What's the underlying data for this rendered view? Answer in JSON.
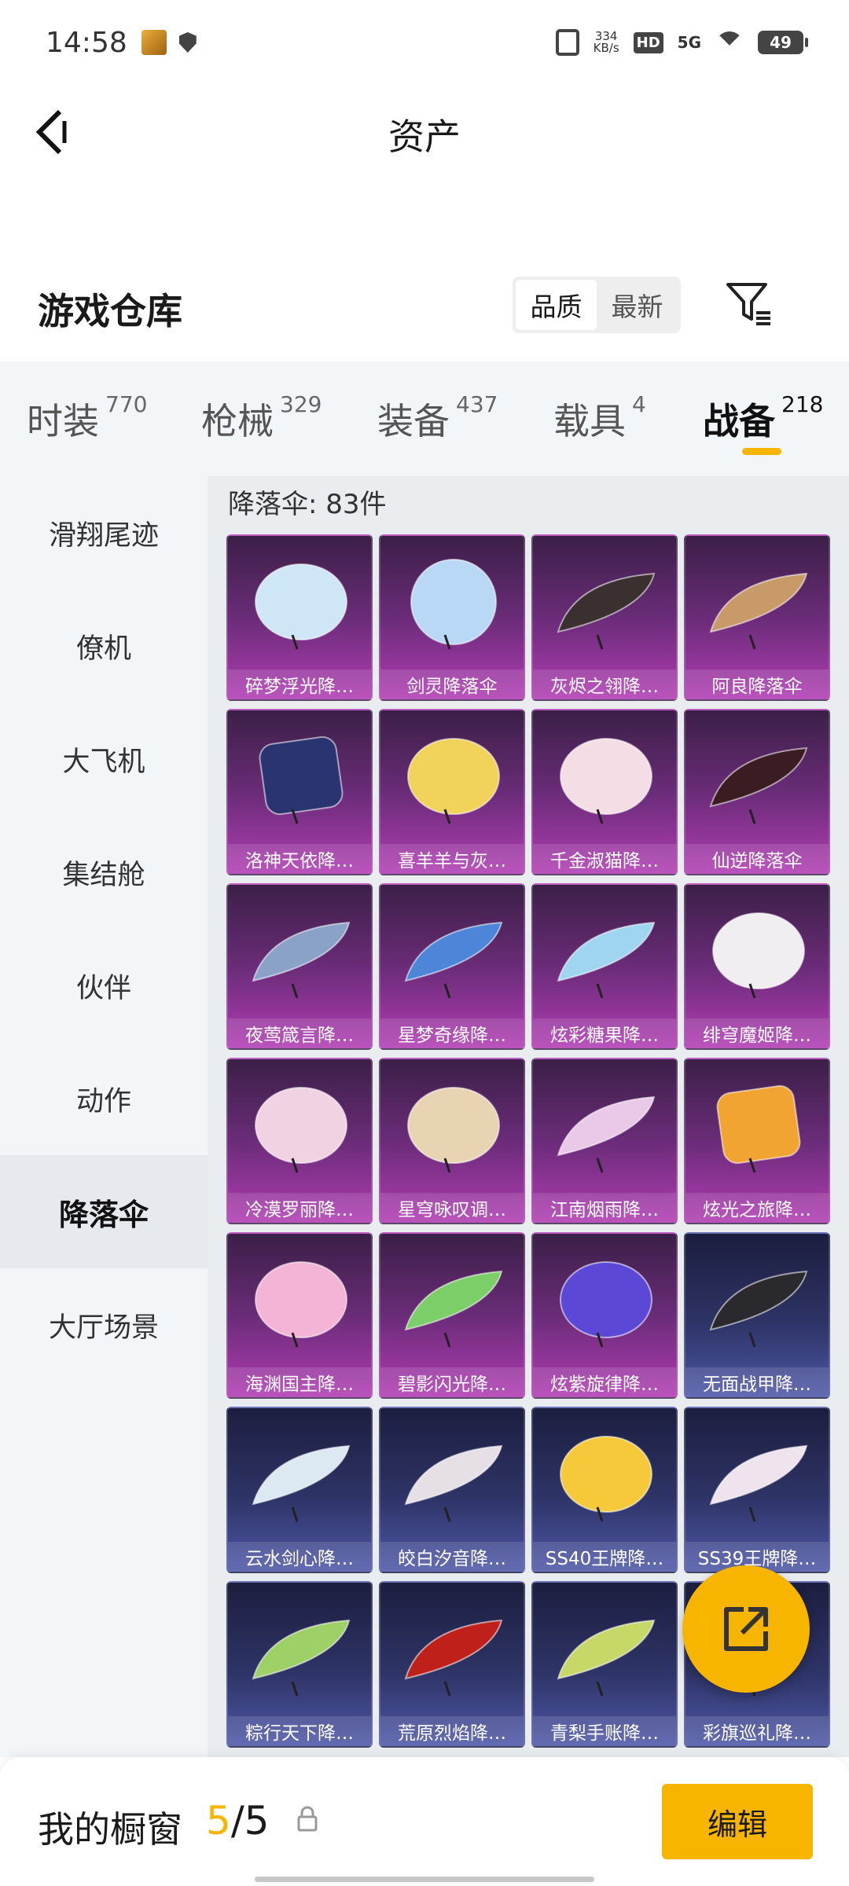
{
  "status_bar": {
    "time": "14:58",
    "net_speed": "334",
    "net_unit": "KB/s",
    "hd": "HD",
    "signal": "5G",
    "battery": "49"
  },
  "header": {
    "title": "资产"
  },
  "warehouse": {
    "title": "游戏仓库",
    "sort_options": [
      "品质",
      "最新"
    ],
    "active_sort": "品质"
  },
  "tabs": [
    {
      "label": "时装",
      "count": "770"
    },
    {
      "label": "枪械",
      "count": "329"
    },
    {
      "label": "装备",
      "count": "437"
    },
    {
      "label": "载具",
      "count": "4"
    },
    {
      "label": "战备",
      "count": "218"
    }
  ],
  "active_tab": "战备",
  "sidebar": {
    "items": [
      "滑翔尾迹",
      "僚机",
      "大飞机",
      "集结舱",
      "伙伴",
      "动作",
      "降落伞",
      "大厅场景"
    ],
    "active": "降落伞"
  },
  "content": {
    "section_title": "降落伞: 83件",
    "items": [
      {
        "name": "碎梦浮光降…",
        "tier": "purple",
        "art": "round",
        "color": "#cfe6f7"
      },
      {
        "name": "剑灵降落伞",
        "tier": "purple",
        "art": "flower",
        "color": "#b9d8f5"
      },
      {
        "name": "灰烬之翎降…",
        "tier": "purple",
        "art": "wing",
        "color": "#3a3030"
      },
      {
        "name": "阿良降落伞",
        "tier": "purple",
        "art": "wing",
        "color": "#c89a6a"
      },
      {
        "name": "洛神天依降…",
        "tier": "purple",
        "art": "square",
        "color": "#2a3470"
      },
      {
        "name": "喜羊羊与灰…",
        "tier": "purple",
        "art": "round",
        "color": "#f1d25a"
      },
      {
        "name": "千金淑猫降…",
        "tier": "purple",
        "art": "round",
        "color": "#f4dde4"
      },
      {
        "name": "仙逆降落伞",
        "tier": "purple",
        "art": "wing",
        "color": "#3a1c22"
      },
      {
        "name": "夜莺箴言降…",
        "tier": "purple",
        "art": "wing",
        "color": "#8aa2c8"
      },
      {
        "name": "星梦奇缘降…",
        "tier": "purple",
        "art": "wing",
        "color": "#4d86d9"
      },
      {
        "name": "炫彩糖果降…",
        "tier": "purple",
        "art": "wing",
        "color": "#9fd5f0"
      },
      {
        "name": "绯穹魔姬降…",
        "tier": "purple",
        "art": "round",
        "color": "#f0eef0"
      },
      {
        "name": "冷漠罗丽降…",
        "tier": "purple",
        "art": "round",
        "color": "#f0d2e2"
      },
      {
        "name": "星穹咏叹调…",
        "tier": "purple",
        "art": "round",
        "color": "#e8d4b2"
      },
      {
        "name": "江南烟雨降…",
        "tier": "purple",
        "art": "wing",
        "color": "#eac8e8"
      },
      {
        "name": "炫光之旅降…",
        "tier": "purple",
        "art": "square",
        "color": "#f2a432"
      },
      {
        "name": "海渊国主降…",
        "tier": "purple",
        "art": "round",
        "color": "#f3b4d6"
      },
      {
        "name": "碧影闪光降…",
        "tier": "purple",
        "art": "wing",
        "color": "#7ccf68"
      },
      {
        "name": "炫紫旋律降…",
        "tier": "purple",
        "art": "round",
        "color": "#5b48d6"
      },
      {
        "name": "无面战甲降…",
        "tier": "blue",
        "art": "wing",
        "color": "#2a2a2e"
      },
      {
        "name": "云水剑心降…",
        "tier": "blue",
        "art": "wing",
        "color": "#dce8f2"
      },
      {
        "name": "皎白汐音降…",
        "tier": "blue",
        "art": "wing",
        "color": "#e6dfe6"
      },
      {
        "name": "SS40王牌降…",
        "tier": "blue",
        "art": "round",
        "color": "#f5c93a"
      },
      {
        "name": "SS39王牌降…",
        "tier": "blue",
        "art": "wing",
        "color": "#efe3ee"
      },
      {
        "name": "粽行天下降…",
        "tier": "blue",
        "art": "wing",
        "color": "#9ed068"
      },
      {
        "name": "荒原烈焰降…",
        "tier": "blue",
        "art": "wing",
        "color": "#c0201a"
      },
      {
        "name": "青梨手账降…",
        "tier": "blue",
        "art": "wing",
        "color": "#c8d868"
      },
      {
        "name": "彩旗巡礼降…",
        "tier": "blue",
        "art": "wing",
        "color": "#d8d2e8"
      }
    ]
  },
  "bottom": {
    "label": "我的橱窗",
    "count_current": "5",
    "count_sep": "/",
    "count_max": "5",
    "edit_label": "编辑"
  }
}
